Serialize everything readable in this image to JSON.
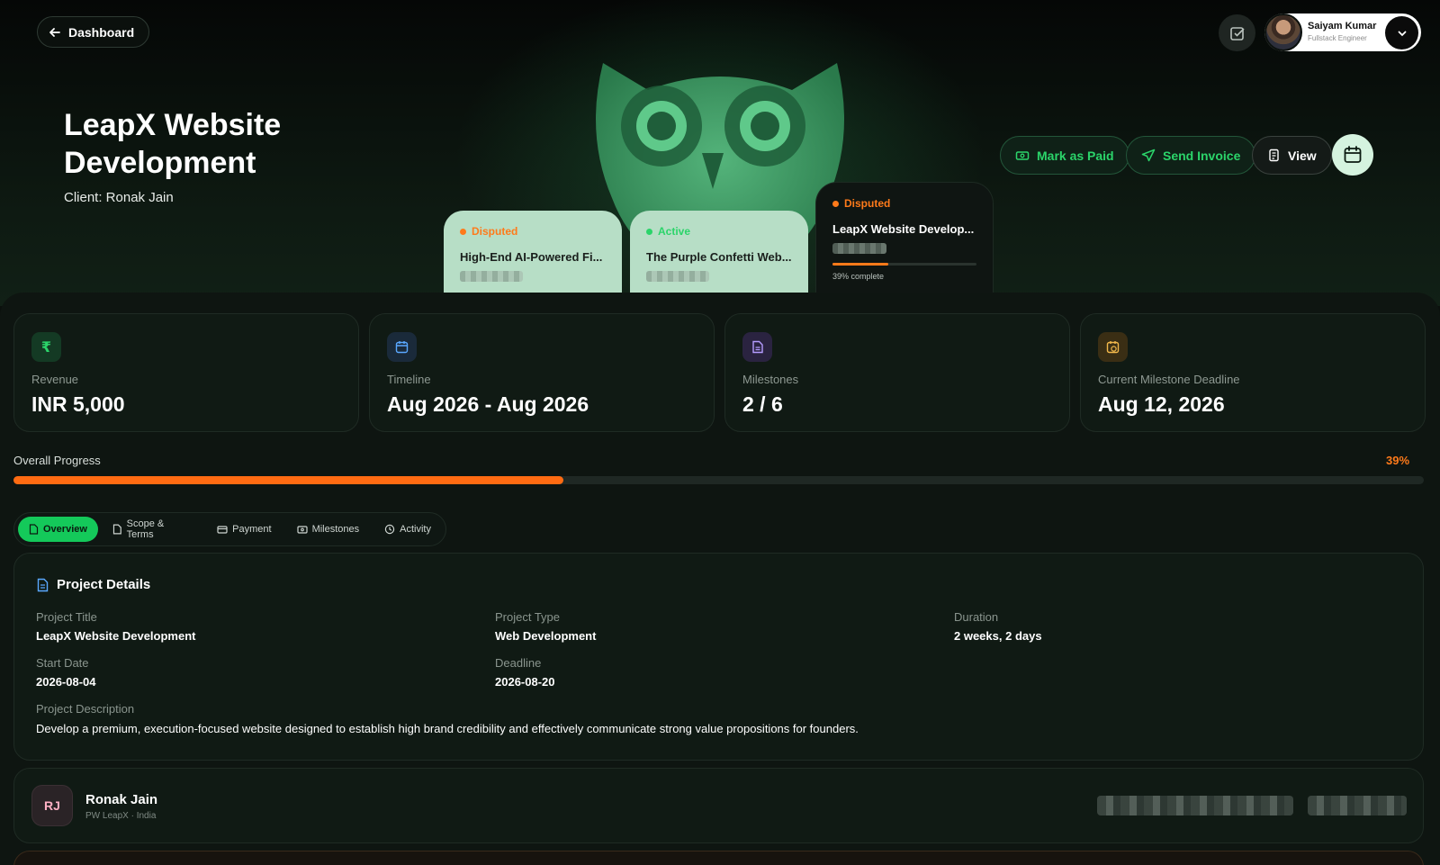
{
  "topbar": {
    "back_label": "Dashboard",
    "user_name": "Saiyam Kumar",
    "user_role": "Fullstack Engineer"
  },
  "header": {
    "title": "LeapX Website Development",
    "client": "Client: Ronak Jain"
  },
  "actions": {
    "mark_paid": "Mark as Paid",
    "send_invoice": "Send Invoice",
    "view": "View"
  },
  "project_cards": [
    {
      "status": "Disputed",
      "title": "High-End AI-Powered Fi...",
      "status_color": "#ff7a1a"
    },
    {
      "status": "Active",
      "title": "The Purple Confetti Web...",
      "status_color": "#2bd46a"
    },
    {
      "status": "Disputed",
      "title": "LeapX Website Develop...",
      "status_color": "#ff7a1a",
      "progress_text": "39% complete",
      "progress": 39
    }
  ],
  "stats": [
    {
      "label": "Revenue",
      "value": "INR 5,000",
      "icon": "rupee-icon",
      "glyph": "₹"
    },
    {
      "label": "Timeline",
      "value": "Aug 2026 - Aug 2026",
      "icon": "calendar-icon"
    },
    {
      "label": "Milestones",
      "value": "2 / 6",
      "icon": "document-icon"
    },
    {
      "label": "Current Milestone Deadline",
      "value": "Aug 12, 2026",
      "icon": "calendar-clock-icon"
    }
  ],
  "progress": {
    "label": "Overall Progress",
    "percent_text": "39%",
    "value": 39
  },
  "tabs": [
    "Overview",
    "Scope & Terms",
    "Payment",
    "Milestones",
    "Activity"
  ],
  "details": {
    "heading": "Project Details",
    "project_title_label": "Project Title",
    "project_title": "LeapX Website Development",
    "project_type_label": "Project Type",
    "project_type": "Web Development",
    "duration_label": "Duration",
    "duration": "2 weeks, 2 days",
    "start_label": "Start Date",
    "start": "2026-08-04",
    "deadline_label": "Deadline",
    "deadline": "2026-08-20",
    "description_label": "Project Description",
    "description": "Develop a premium, execution-focused website designed to establish high brand credibility and effectively communicate strong value propositions for founders."
  },
  "client_card": {
    "initials": "RJ",
    "name": "Ronak Jain",
    "org": "PW LeapX · India"
  },
  "colors": {
    "accent_green": "#14c95a",
    "accent_orange": "#ff6b12",
    "background": "#0b100d"
  }
}
